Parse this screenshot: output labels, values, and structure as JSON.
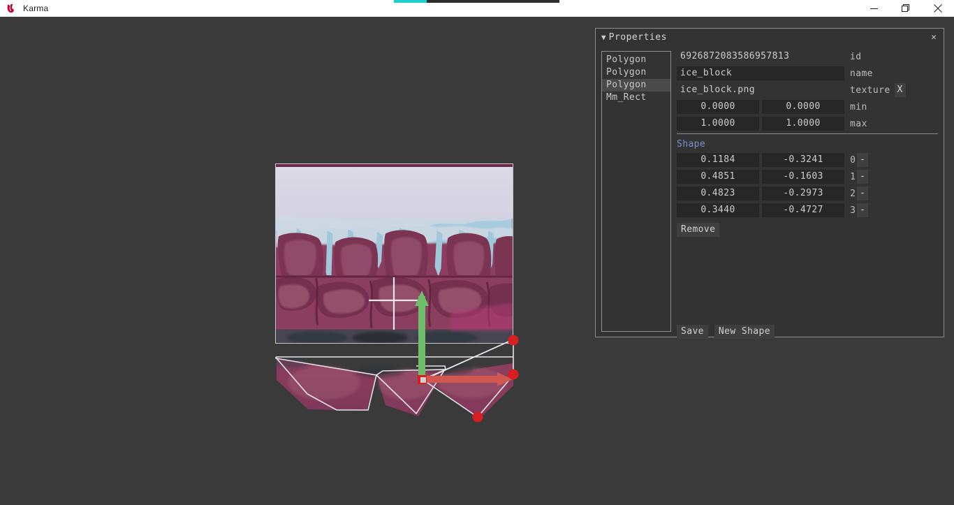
{
  "window": {
    "app_title": "Karma",
    "logo_icon": "karma-logo-icon",
    "minimize_label": "—",
    "maximize_label": "❐",
    "close_label": "✕"
  },
  "progress": {
    "percent": 20,
    "fill_color": "#1fcfd0",
    "track_color": "#2d2d2d"
  },
  "panel": {
    "title": "Properties",
    "caret": "▼",
    "close_label": "✕"
  },
  "object_list": {
    "items": [
      {
        "label": "Polygon",
        "selected": false
      },
      {
        "label": "Polygon",
        "selected": false
      },
      {
        "label": "Polygon",
        "selected": true
      },
      {
        "label": "Mm_Rect",
        "selected": false
      }
    ]
  },
  "properties": {
    "id_value": "6926872083586957813",
    "id_label": "id",
    "name_value": "ice_block",
    "name_label": "name",
    "texture_value": "ice_block.png",
    "texture_label": "texture",
    "texture_clear_label": "X",
    "min_x": "0.0000",
    "min_y": "0.0000",
    "min_label": "min",
    "max_x": "1.0000",
    "max_y": "1.0000",
    "max_label": "max"
  },
  "shape": {
    "header": "Shape",
    "points": [
      {
        "x": "0.1184",
        "y": "-0.3241",
        "index": "0",
        "remove_label": "-"
      },
      {
        "x": "0.4851",
        "y": "-0.1603",
        "index": "1",
        "remove_label": "-"
      },
      {
        "x": "0.4823",
        "y": "-0.2973",
        "index": "2",
        "remove_label": "-"
      },
      {
        "x": "0.3440",
        "y": "-0.4727",
        "index": "3",
        "remove_label": "-"
      }
    ],
    "remove_label": "Remove"
  },
  "actions": {
    "save_label": "Save",
    "new_shape_label": "New Shape"
  },
  "canvas": {
    "sprite_name": "ice_block",
    "gizmo": {
      "y_axis_color": "#6fbf6a",
      "x_axis_color": "#d1584f",
      "handle_color": "#d81f1f",
      "origin_color": "#d81f1f"
    },
    "cursor": "crosshair-cursor",
    "outline_color": "#e8e4ea"
  },
  "colors": {
    "app_bg": "#3a3a3a",
    "panel_bg": "#333333",
    "panel_border": "#8e8e8e",
    "field_bg": "#272727",
    "section_accent": "#7f8fd0"
  }
}
